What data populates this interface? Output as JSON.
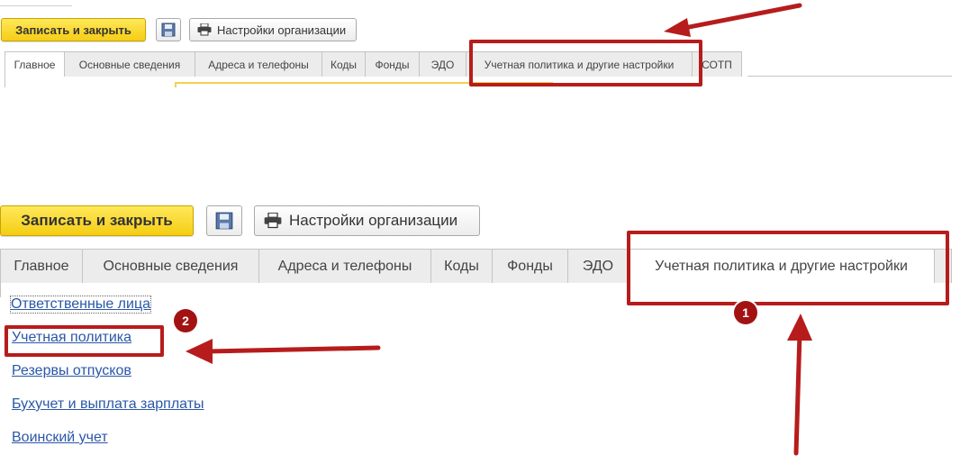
{
  "toolbar": {
    "save_close_label": "Записать и закрыть",
    "save_icon": "floppy-disk-icon",
    "print_icon": "printer-icon",
    "org_settings_label": "Настройки организации"
  },
  "tabs": [
    {
      "label": "Главное"
    },
    {
      "label": "Основные сведения"
    },
    {
      "label": "Адреса и телефоны"
    },
    {
      "label": "Коды"
    },
    {
      "label": "Фонды"
    },
    {
      "label": "ЭДО"
    },
    {
      "label": "Учетная политика и другие настройки"
    },
    {
      "label": "СОТП"
    }
  ],
  "tabs_bottom": [
    {
      "label": "Главное"
    },
    {
      "label": "Основные сведения"
    },
    {
      "label": "Адреса и телефоны"
    },
    {
      "label": "Коды"
    },
    {
      "label": "Фонды"
    },
    {
      "label": "ЭДО"
    },
    {
      "label": "Учетная политика и другие настройки"
    }
  ],
  "links": [
    {
      "label": "Ответственные лица"
    },
    {
      "label": "Учетная политика"
    },
    {
      "label": "Резервы отпусков"
    },
    {
      "label": "Бухучет и выплата зарплаты"
    },
    {
      "label": "Воинский учет"
    }
  ],
  "annotations": {
    "badge_1": "1",
    "badge_2": "2"
  },
  "colors": {
    "accent_yellow": "#f5cd13",
    "annotation_red": "#b71c1c",
    "link_blue": "#2a57a8"
  }
}
